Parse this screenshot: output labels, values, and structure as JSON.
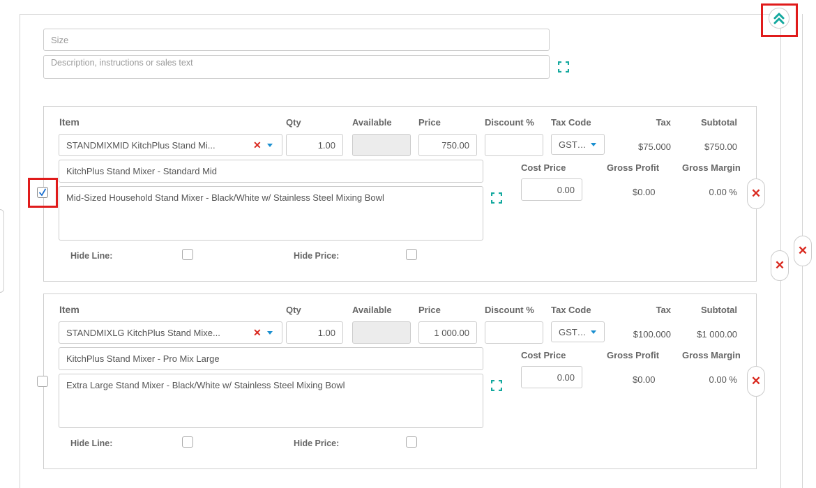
{
  "header": {
    "size_placeholder": "Size",
    "description_placeholder": "Description, instructions or sales text"
  },
  "columns": {
    "item": "Item",
    "qty": "Qty",
    "available": "Available",
    "price": "Price",
    "discount": "Discount %",
    "tax_code": "Tax Code",
    "tax": "Tax",
    "subtotal": "Subtotal",
    "cost_price": "Cost Price",
    "gross_profit": "Gross Profit",
    "gross_margin": "Gross Margin",
    "hide_line": "Hide Line:",
    "hide_price": "Hide Price:"
  },
  "lines": [
    {
      "selected": true,
      "item": "STANDMIXMID KitchPlus Stand Mi...",
      "qty": "1.00",
      "available": "",
      "price": "750.00",
      "discount": "",
      "tax_code": "GST ...",
      "tax": "$75.000",
      "subtotal": "$750.00",
      "name": "KitchPlus Stand Mixer - Standard Mid",
      "description": "Mid-Sized Household Stand Mixer - Black/White w/ Stainless Steel Mixing Bowl",
      "cost_price": "0.00",
      "gross_profit": "$0.00",
      "gross_margin": "0.00 %"
    },
    {
      "selected": false,
      "item": "STANDMIXLG KitchPlus Stand Mixe...",
      "qty": "1.00",
      "available": "",
      "price": "1 000.00",
      "discount": "",
      "tax_code": "GST ...",
      "tax": "$100.000",
      "subtotal": "$1 000.00",
      "name": "KitchPlus Stand Mixer - Pro Mix Large",
      "description": "Extra Large Stand Mixer - Black/White w/ Stainless Steel Mixing Bowl",
      "cost_price": "0.00",
      "gross_profit": "$0.00",
      "gross_margin": "0.00 %"
    }
  ],
  "icons": {
    "collapse": "double-chevron-up-icon",
    "expand": "expand-icon",
    "remove": "red-x-icon",
    "dropdown": "caret-down-icon"
  },
  "colors": {
    "accent": "#13a89e",
    "danger": "#d9281e",
    "dropdown": "#1a8fd0",
    "highlight": "#e01b1b"
  }
}
